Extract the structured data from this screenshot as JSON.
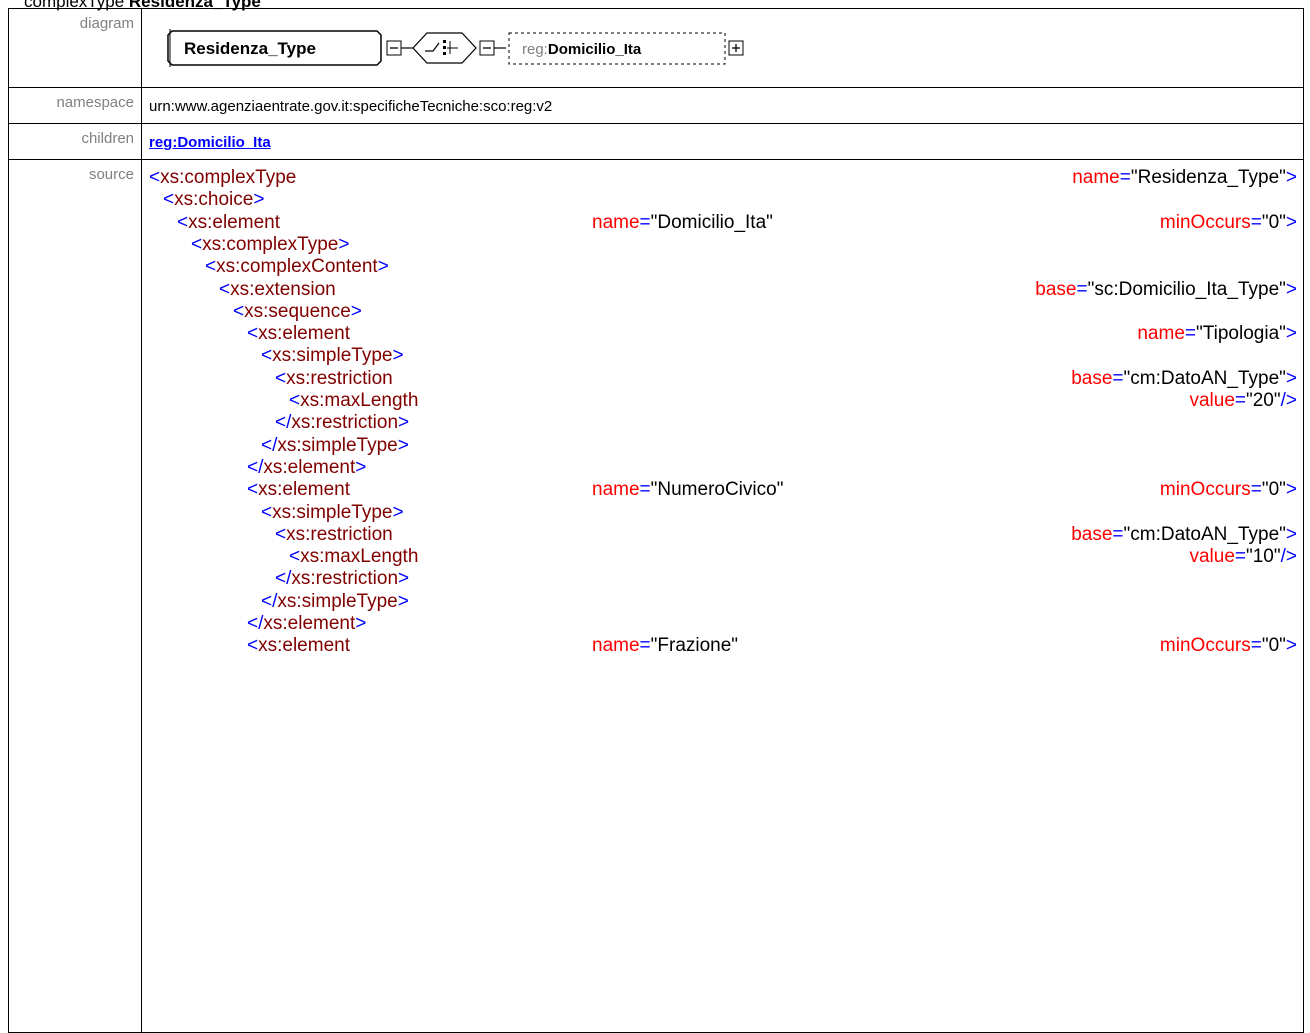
{
  "title": {
    "kind": "complexType",
    "name": "Residenza_Type"
  },
  "labels": {
    "diagram": "diagram",
    "namespace": "namespace",
    "children": "children",
    "source": "source"
  },
  "diagram": {
    "type_box": "Residenza_Type",
    "element_prefix": "reg:",
    "element_name": "Domicilio_Ita"
  },
  "namespace": "urn:www.agenziaentrate.gov.it:specificheTecniche:sco:reg:v2",
  "children": [
    "reg:Domicilio_Ita"
  ],
  "source": {
    "lines": [
      {
        "tag": "<xs:complexType",
        "attrs": [
          {
            "name": "name",
            "value": "\"Residenza_Type\"",
            "end": ">"
          }
        ]
      },
      {
        "tag": "<xs:choice>",
        "attrs": []
      },
      {
        "tag": "<xs:element",
        "attrs": [
          {
            "name": "name",
            "value": "\"Domicilio_Ita\"",
            "end": ""
          },
          {
            "name": "minOccurs",
            "value": "\"0\"",
            "end": ">"
          }
        ]
      },
      {
        "tag": "<xs:complexType>",
        "attrs": []
      },
      {
        "tag": "<xs:complexContent>",
        "attrs": []
      },
      {
        "tag": "<xs:extension",
        "attrs": [
          {
            "name": "base",
            "value": "\"sc:Domicilio_Ita_Type\"",
            "end": ">"
          }
        ]
      },
      {
        "tag": "<xs:sequence>",
        "attrs": []
      },
      {
        "tag": "<xs:element",
        "attrs": [
          {
            "name": "name",
            "value": "\"Tipologia\"",
            "end": ">"
          }
        ]
      },
      {
        "tag": "<xs:simpleType>",
        "attrs": []
      },
      {
        "tag": "<xs:restriction",
        "attrs": [
          {
            "name": "base",
            "value": "\"cm:DatoAN_Type\"",
            "end": ">"
          }
        ]
      },
      {
        "tag": "<xs:maxLength",
        "attrs": [
          {
            "name": "value",
            "value": "\"20\"",
            "end": "/>"
          }
        ]
      },
      {
        "tag": "</xs:restriction>",
        "attrs": []
      },
      {
        "tag": "</xs:simpleType>",
        "attrs": []
      },
      {
        "tag": "</xs:element>",
        "attrs": []
      },
      {
        "tag": "<xs:element",
        "attrs": [
          {
            "name": "name",
            "value": "\"NumeroCivico\"",
            "end": ""
          },
          {
            "name": "minOccurs",
            "value": "\"0\"",
            "end": ">"
          }
        ]
      },
      {
        "tag": "<xs:simpleType>",
        "attrs": []
      },
      {
        "tag": "<xs:restriction",
        "attrs": [
          {
            "name": "base",
            "value": "\"cm:DatoAN_Type\"",
            "end": ">"
          }
        ]
      },
      {
        "tag": "<xs:maxLength",
        "attrs": [
          {
            "name": "value",
            "value": "\"10\"",
            "end": "/>"
          }
        ]
      },
      {
        "tag": "</xs:restriction>",
        "attrs": []
      },
      {
        "tag": "</xs:simpleType>",
        "attrs": []
      },
      {
        "tag": "</xs:element>",
        "attrs": []
      },
      {
        "tag": "<xs:element",
        "attrs": [
          {
            "name": "name",
            "value": "\"Frazione\"",
            "end": ""
          },
          {
            "name": "minOccurs",
            "value": "\"0\"",
            "end": ">"
          }
        ]
      }
    ]
  }
}
